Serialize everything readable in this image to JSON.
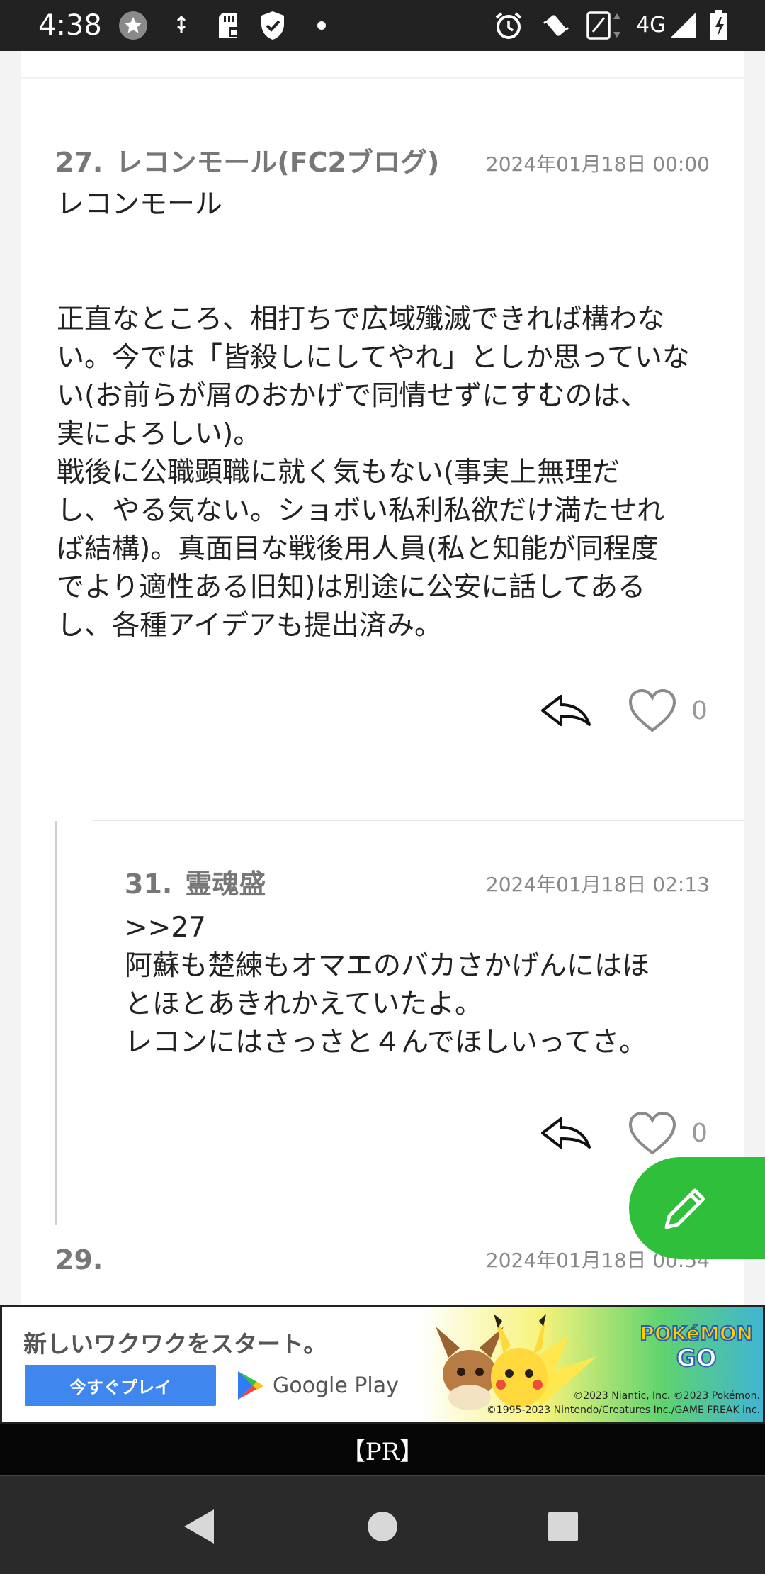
{
  "status_bar": {
    "time": "4:38",
    "network": "4G",
    "icons": [
      "star-icon",
      "usb-icon",
      "sd-card-icon",
      "shield-check-icon",
      "dot-icon",
      "alarm-icon",
      "vibrate-icon",
      "data-transfer-icon",
      "signal-icon",
      "battery-charging-icon"
    ]
  },
  "comments": [
    {
      "number": "27.",
      "author": "レコンモール(FC2ブログ)",
      "date": "2024年01月18日 00:00",
      "body": "レコンモール\n\n\n正直なところ、相打ちで広域殲滅できれば構わな\nい。今では「皆殺しにしてやれ」としか思っていな\nい(お前らが屑のおかげで同情せずにすむのは、\n実によろしい)。\n戦後に公職顕職に就く気もない(事実上無理だ\nし、やる気ない。ショボい私利私欲だけ満たせれ\nば結構)。真面目な戦後用人員(私と知能が同程度\nでより適性ある旧知)は別途に公安に話してある\nし、各種アイデアも提出済み。",
      "likes": "0"
    },
    {
      "number": "31.",
      "author": "霊魂盛",
      "date": "2024年01月18日 02:13",
      "body": ">>27\n阿蘇も楚練もオマエのバカさかげんにはほ\nとほとあきれかえていたよ。\nレコンにはさっさと４んでほしいってさ。",
      "likes": "0"
    },
    {
      "number": "29.",
      "author": "",
      "date": "2024年01月18日 00:54"
    }
  ],
  "ad": {
    "headline": "新しいワクワクをスタート。",
    "cta": "今すぐプレイ",
    "store": "Google Play",
    "brand_top": "POKéMON",
    "brand_bottom": "GO",
    "copyright_1": "©2023 Niantic, Inc. ©2023 Pokémon.",
    "copyright_2": "©1995-2023 Nintendo/Creatures Inc./GAME FREAK inc."
  },
  "pr_label": "【PR】",
  "colors": {
    "fab": "#2fbf3a",
    "ad_button": "#3f86ee",
    "status_bar": "#222222"
  }
}
